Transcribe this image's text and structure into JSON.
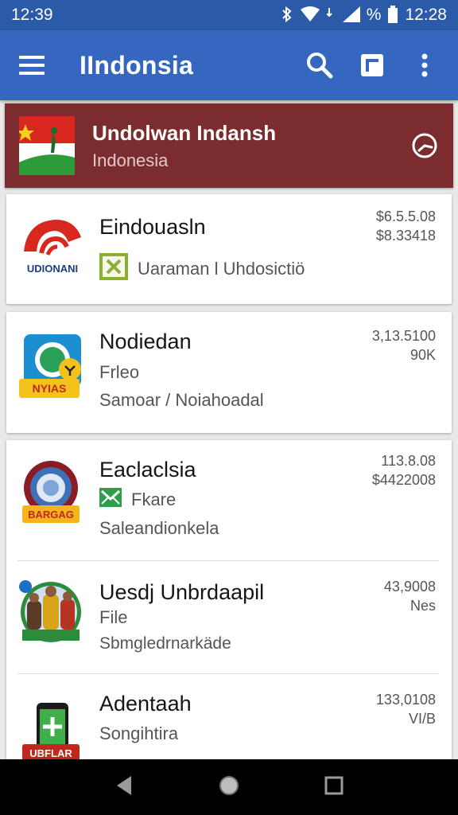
{
  "status_bar": {
    "time_left": "12:39",
    "time_right": "12:28",
    "battery_label": "%"
  },
  "app_bar": {
    "title": "IIndonsia"
  },
  "banner": {
    "title": "Undolwan Indansh",
    "subtitle": "Indonesia"
  },
  "items": [
    {
      "title": "Eindouasln",
      "line1": "Uaraman l Uhdosictiö",
      "line2": "",
      "price1": "$6.5.5.08",
      "price2": "$8.33418",
      "logo_text": "UDIONANI"
    },
    {
      "title": "Nodiedan",
      "line1": "Frleo",
      "line2": "Samoar / Noiahoadal",
      "price1": "3,13.5100",
      "price2": "90K",
      "logo_text": "NYIAS"
    },
    {
      "title": "Eaclaclsia",
      "line1": "Fkare",
      "line2": "Saleandionkela",
      "price1": "113.8.08",
      "price2": "$4422008",
      "logo_text": "BARGAG"
    },
    {
      "title": "Uesdj Unbrdaapil",
      "line1": "File",
      "line2": "Sbmgledrnarkäde",
      "price1": "43,9008",
      "price2": "Nes",
      "logo_text": ""
    },
    {
      "title": "Adentaah",
      "line1": "Songihtira",
      "line2": "",
      "price1": "133,0108",
      "price2": "VI/B",
      "logo_text": "UBFLAR"
    }
  ],
  "colors": {
    "status_bar": "#2a5aa8",
    "app_bar": "#3567c0",
    "banner": "#7a2c2f",
    "check": "#8ab12c"
  }
}
